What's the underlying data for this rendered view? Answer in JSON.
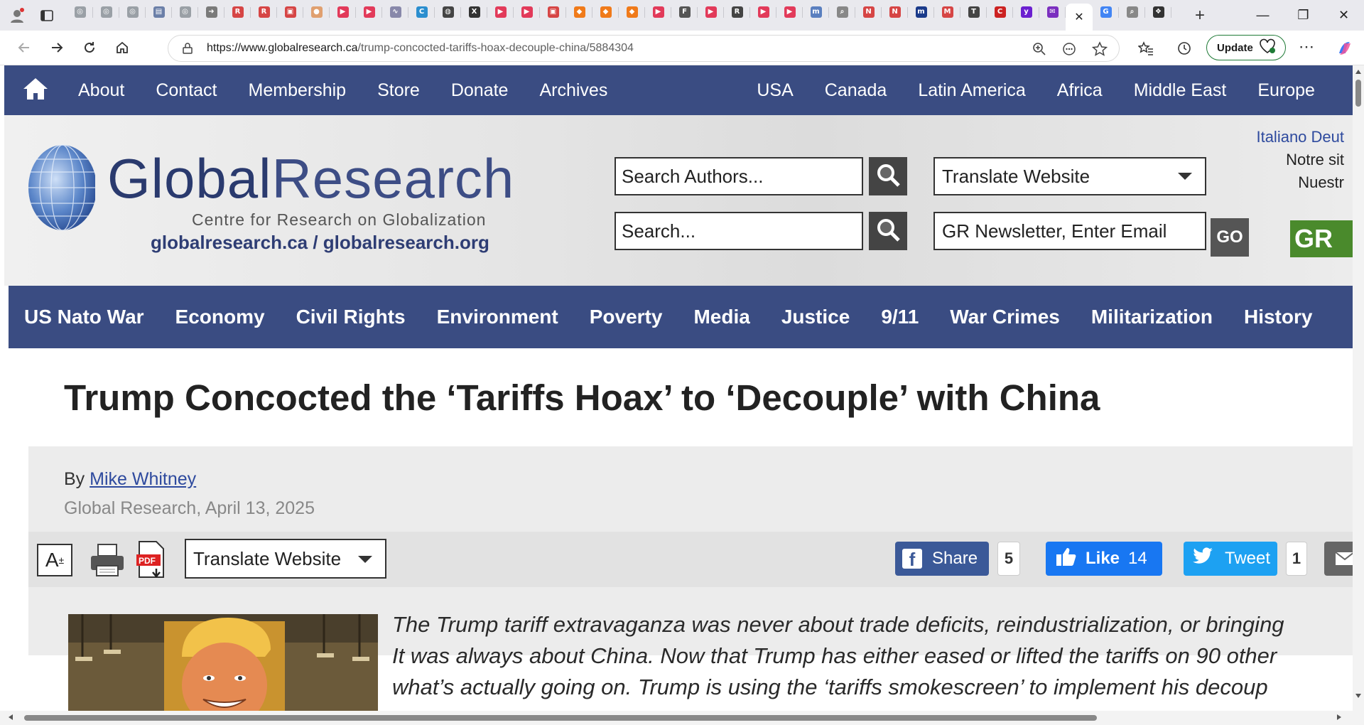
{
  "browser": {
    "url_host": "https://www.globalresearch.ca",
    "url_path": "/trump-concocted-tariffs-hoax-decouple-china/5884304",
    "update_label": "Update",
    "tabs": [
      {
        "icon": "globe-icon",
        "color": "#9aa0a6",
        "glyph": "◎"
      },
      {
        "icon": "globe-icon",
        "color": "#9aa0a6",
        "glyph": "◎"
      },
      {
        "icon": "globe-icon",
        "color": "#9aa0a6",
        "glyph": "◎"
      },
      {
        "icon": "news-icon",
        "color": "#6b7fa8",
        "glyph": "▤"
      },
      {
        "icon": "globe-icon",
        "color": "#9aa0a6",
        "glyph": "◎"
      },
      {
        "icon": "arrow-icon",
        "color": "#7a7a7a",
        "glyph": "➜"
      },
      {
        "icon": "r-icon",
        "color": "#d64545",
        "glyph": "R"
      },
      {
        "icon": "r-icon",
        "color": "#d64545",
        "glyph": "R"
      },
      {
        "icon": "pdf-icon",
        "color": "#d64545",
        "glyph": "▣"
      },
      {
        "icon": "circle-icon",
        "color": "#e0a070",
        "glyph": "●"
      },
      {
        "icon": "youtube-icon",
        "color": "#e23a5a",
        "glyph": "▶"
      },
      {
        "icon": "youtube-icon",
        "color": "#e23a5a",
        "glyph": "▶"
      },
      {
        "icon": "wave-icon",
        "color": "#88a",
        "glyph": "∿"
      },
      {
        "icon": "c-icon",
        "color": "#2b8ecf",
        "glyph": "C"
      },
      {
        "icon": "ghost-icon",
        "color": "#444",
        "glyph": "◍"
      },
      {
        "icon": "x-icon",
        "color": "#333",
        "glyph": "X"
      },
      {
        "icon": "youtube-icon",
        "color": "#e23a5a",
        "glyph": "▶"
      },
      {
        "icon": "youtube-icon",
        "color": "#e23a5a",
        "glyph": "▶"
      },
      {
        "icon": "pdf-icon",
        "color": "#d64545",
        "glyph": "▣"
      },
      {
        "icon": "bookmark-icon",
        "color": "#f07a1a",
        "glyph": "◆"
      },
      {
        "icon": "bookmark-icon",
        "color": "#f07a1a",
        "glyph": "◆"
      },
      {
        "icon": "bookmark-icon",
        "color": "#f07a1a",
        "glyph": "◆"
      },
      {
        "icon": "youtube-icon",
        "color": "#e23a5a",
        "glyph": "▶"
      },
      {
        "icon": "fp-icon",
        "color": "#555",
        "glyph": "F"
      },
      {
        "icon": "youtube-icon",
        "color": "#e23a5a",
        "glyph": "▶"
      },
      {
        "icon": "r-icon",
        "color": "#444",
        "glyph": "R"
      },
      {
        "icon": "youtube-icon",
        "color": "#e23a5a",
        "glyph": "▶"
      },
      {
        "icon": "youtube-icon",
        "color": "#e23a5a",
        "glyph": "▶"
      },
      {
        "icon": "m-icon",
        "color": "#5a7fbf",
        "glyph": "m"
      },
      {
        "icon": "search-icon",
        "color": "#888",
        "glyph": "⌕"
      },
      {
        "icon": "n-icon",
        "color": "#d64545",
        "glyph": "N"
      },
      {
        "icon": "n-icon",
        "color": "#d64545",
        "glyph": "N"
      },
      {
        "icon": "m-icon",
        "color": "#1a3a8a",
        "glyph": "m"
      },
      {
        "icon": "m-icon",
        "color": "#d64545",
        "glyph": "M"
      },
      {
        "icon": "t-icon",
        "color": "#444",
        "glyph": "T"
      },
      {
        "icon": "cnn-icon",
        "color": "#cc2222",
        "glyph": "C"
      },
      {
        "icon": "yahoo-icon",
        "color": "#6b1fd0",
        "glyph": "y"
      },
      {
        "icon": "mail-icon",
        "color": "#7b2fbf",
        "glyph": "✉"
      },
      {
        "icon": "close-icon",
        "color": "#222",
        "glyph": "✕",
        "active": true
      },
      {
        "icon": "google-icon",
        "color": "#4285f4",
        "glyph": "G"
      },
      {
        "icon": "search-icon",
        "color": "#888",
        "glyph": "⌕"
      },
      {
        "icon": "copilot-icon",
        "color": "#333",
        "glyph": "❖"
      }
    ]
  },
  "topnav": {
    "items": [
      "About",
      "Contact",
      "Membership",
      "Store",
      "Donate",
      "Archives"
    ],
    "regions": [
      "USA",
      "Canada",
      "Latin America",
      "Africa",
      "Middle East",
      "Europe"
    ]
  },
  "header": {
    "logo_title_a": "Global",
    "logo_title_b": "Research",
    "logo_sub": "Centre for Research on Globalization",
    "logo_url": "globalresearch.ca / globalresearch.org",
    "search_authors": "Search Authors...",
    "search": "Search...",
    "translate": "Translate Website",
    "newsletter": "GR Newsletter, Enter Email",
    "go": "GO",
    "lang_line1": "Italiano  Deut",
    "lang_line2": "Notre sit",
    "lang_line3": "Nuestr",
    "gr_banner": "GR"
  },
  "catnav": [
    "US Nato War",
    "Economy",
    "Civil Rights",
    "Environment",
    "Poverty",
    "Media",
    "Justice",
    "9/11",
    "War Crimes",
    "Militarization",
    "History"
  ],
  "article": {
    "title": "Trump Concocted the ‘Tariffs Hoax’ to ‘Decouple’ with China",
    "by_prefix": "By ",
    "author": "Mike Whitney",
    "date": "Global Research, April 13, 2025",
    "translate": "Translate Website",
    "share_label": "Share",
    "share_count": "5",
    "like_label": "Like",
    "like_count": "14",
    "tweet_label": "Tweet",
    "tweet_count": "1",
    "lede_1": "The Trump tariff extravaganza was never about trade deficits, reindustrialization, or bringing",
    "lede_2": "It was always about China. Now that Trump has either eased or lifted the tariffs on 90 other",
    "lede_3": "what’s actually going on. Trump is using the ‘tariffs smokescreen’ to implement his decoup"
  },
  "colors": {
    "brand": "#3a4c82",
    "facebook": "#3b5998",
    "like": "#1877f2",
    "twitter": "#1da1f2"
  }
}
